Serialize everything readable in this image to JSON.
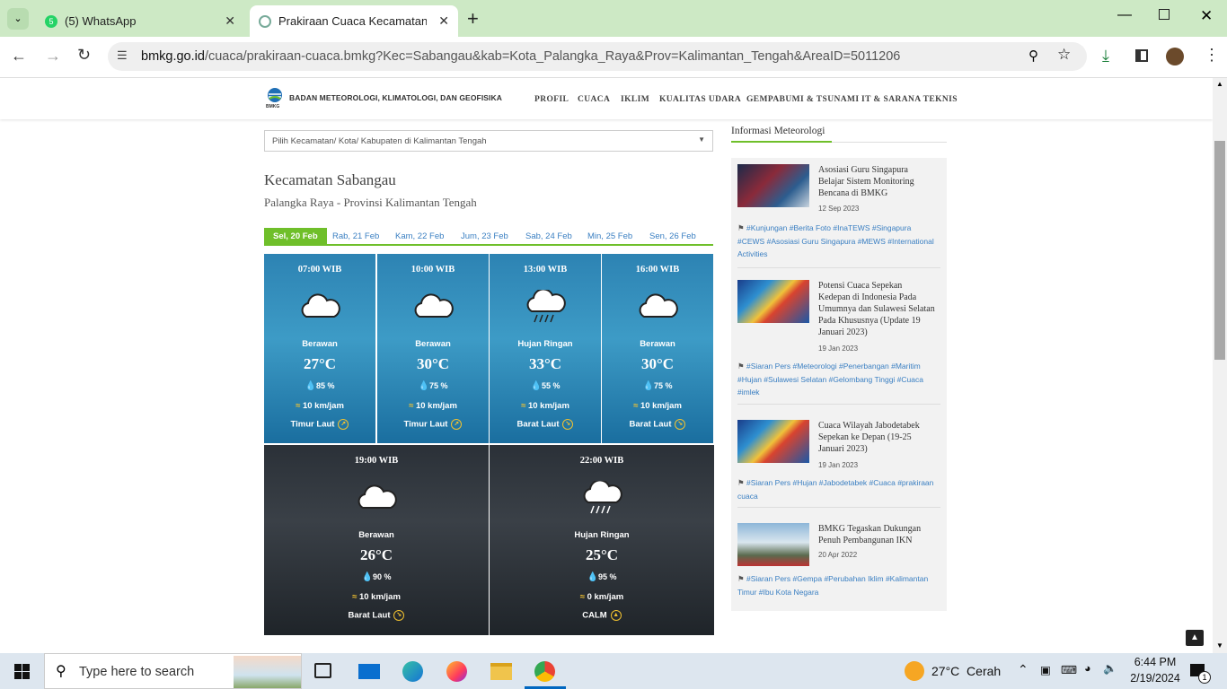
{
  "browser": {
    "tabs": [
      {
        "label": "(5) WhatsApp"
      },
      {
        "label": "Prakiraan Cuaca Kecamatan Sab"
      }
    ],
    "url_domain": "bmkg.go.id",
    "url_path": "/cuaca/prakiraan-cuaca.bmkg?Kec=Sabangau&kab=Kota_Palangka_Raya&Prov=Kalimantan_Tengah&AreaID=5011206"
  },
  "site": {
    "logo_abbr": "BMKG",
    "logo_text": "BADAN METEOROLOGI, KLIMATOLOGI, DAN GEOFISIKA",
    "nav": [
      "PROFIL",
      "CUACA",
      "IKLIM",
      "KUALITAS UDARA",
      "GEMPABUMI & TSUNAMI",
      "IT & SARANA TEKNIS"
    ]
  },
  "forecast": {
    "select_label": "Pilih Kecamatan/ Kota/ Kabupaten di Kalimantan Tengah",
    "title": "Kecamatan Sabangau",
    "subtitle": "Palangka Raya - Provinsi Kalimantan Tengah",
    "days": [
      "Sel, 20 Feb",
      "Rab, 21 Feb",
      "Kam, 22 Feb",
      "Jum, 23 Feb",
      "Sab, 24 Feb",
      "Min, 25 Feb",
      "Sen, 26 Feb"
    ],
    "slots": [
      {
        "time": "07:00 WIB",
        "cond": "Berawan",
        "temp": "27°C",
        "hum": "85 %",
        "wind": "10 km/jam",
        "dir": "Timur Laut",
        "icon": "cloud-icon"
      },
      {
        "time": "10:00 WIB",
        "cond": "Berawan",
        "temp": "30°C",
        "hum": "75 %",
        "wind": "10 km/jam",
        "dir": "Timur Laut",
        "icon": "cloud-icon"
      },
      {
        "time": "13:00 WIB",
        "cond": "Hujan Ringan",
        "temp": "33°C",
        "hum": "55 %",
        "wind": "10 km/jam",
        "dir": "Barat Laut",
        "icon": "rain-cloud-icon"
      },
      {
        "time": "16:00 WIB",
        "cond": "Berawan",
        "temp": "30°C",
        "hum": "75 %",
        "wind": "10 km/jam",
        "dir": "Barat Laut",
        "icon": "cloud-icon"
      },
      {
        "time": "19:00 WIB",
        "cond": "Berawan",
        "temp": "26°C",
        "hum": "90 %",
        "wind": "10 km/jam",
        "dir": "Barat Laut",
        "icon": "cloud-icon"
      },
      {
        "time": "22:00 WIB",
        "cond": "Hujan Ringan",
        "temp": "25°C",
        "hum": "95 %",
        "wind": "0 km/jam",
        "dir": "CALM",
        "icon": "rain-cloud-icon"
      }
    ]
  },
  "sidebar": {
    "title": "Informasi Meteorologi",
    "news": [
      {
        "title": "Asosiasi Guru Singapura Belajar Sistem Monitoring Bencana di BMKG",
        "date": "12 Sep 2023",
        "tags": "#Kunjungan #Berita Foto #InaTEWS #Singapura #CEWS #Asosiasi Guru Singapura #MEWS #International Activities"
      },
      {
        "title": "Potensi Cuaca Sepekan Kedepan di Indonesia Pada Umumnya dan Sulawesi Selatan Pada Khususnya (Update 19 Januari 2023)",
        "date": "19 Jan 2023",
        "tags": "#Siaran Pers #Meteorologi #Penerbangan #Maritim #Hujan #Sulawesi Selatan #Gelombang Tinggi #Cuaca #imlek"
      },
      {
        "title": "Cuaca Wilayah Jabodetabek Sepekan ke Depan (19-25 Januari 2023)",
        "date": "19 Jan 2023",
        "tags": "#Siaran Pers #Hujan #Jabodetabek #Cuaca #prakiraan cuaca"
      },
      {
        "title": "BMKG Tegaskan Dukungan Penuh Pembangunan IKN",
        "date": "20 Apr 2022",
        "tags": "#Siaran Pers #Gempa #Perubahan Iklim #Kalimantan Timur #Ibu Kota Negara"
      }
    ]
  },
  "taskbar": {
    "search_placeholder": "Type here to search",
    "weather": "27°C  Cerah",
    "time": "6:44 PM",
    "date": "2/19/2024",
    "notif_count": "1"
  }
}
